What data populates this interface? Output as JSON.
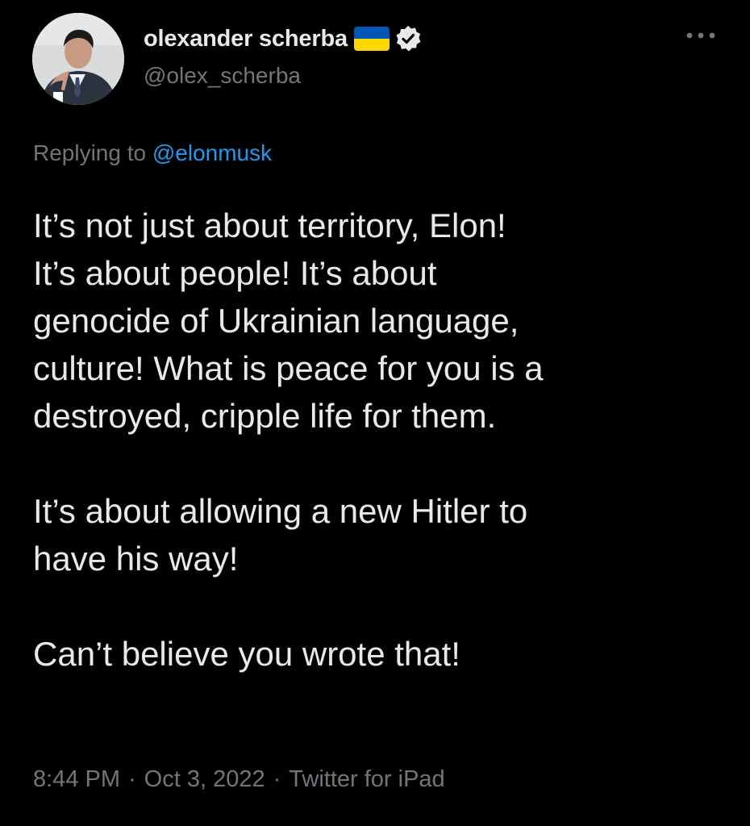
{
  "author": {
    "display_name": "olexander scherba",
    "handle": "@olex_scherba",
    "flag_icon": "ukraine-flag-icon",
    "verified_icon": "verified-badge-icon",
    "avatar_icon": "profile-avatar"
  },
  "menu": {
    "more_icon": "more-horizontal-icon"
  },
  "reply": {
    "prefix": "Replying to",
    "mention": "@elonmusk"
  },
  "tweet": {
    "paragraphs": [
      "It’s not just about territory, Elon!\nIt’s about people! It’s about\ngenocide of Ukrainian language,\nculture! What is peace for you is a\ndestroyed, cripple life for them.",
      "It’s about allowing a new Hitler to\nhave his way!",
      "Can’t believe you wrote that!"
    ]
  },
  "meta": {
    "time": "8:44 PM",
    "separator": "·",
    "date": "Oct 3, 2022",
    "source": "Twitter for iPad"
  },
  "colors": {
    "background": "#000000",
    "text": "#e7e9ea",
    "secondary": "#71767b",
    "link": "#1d9bf0",
    "flag_blue": "#0057b7",
    "flag_yellow": "#ffd700"
  }
}
